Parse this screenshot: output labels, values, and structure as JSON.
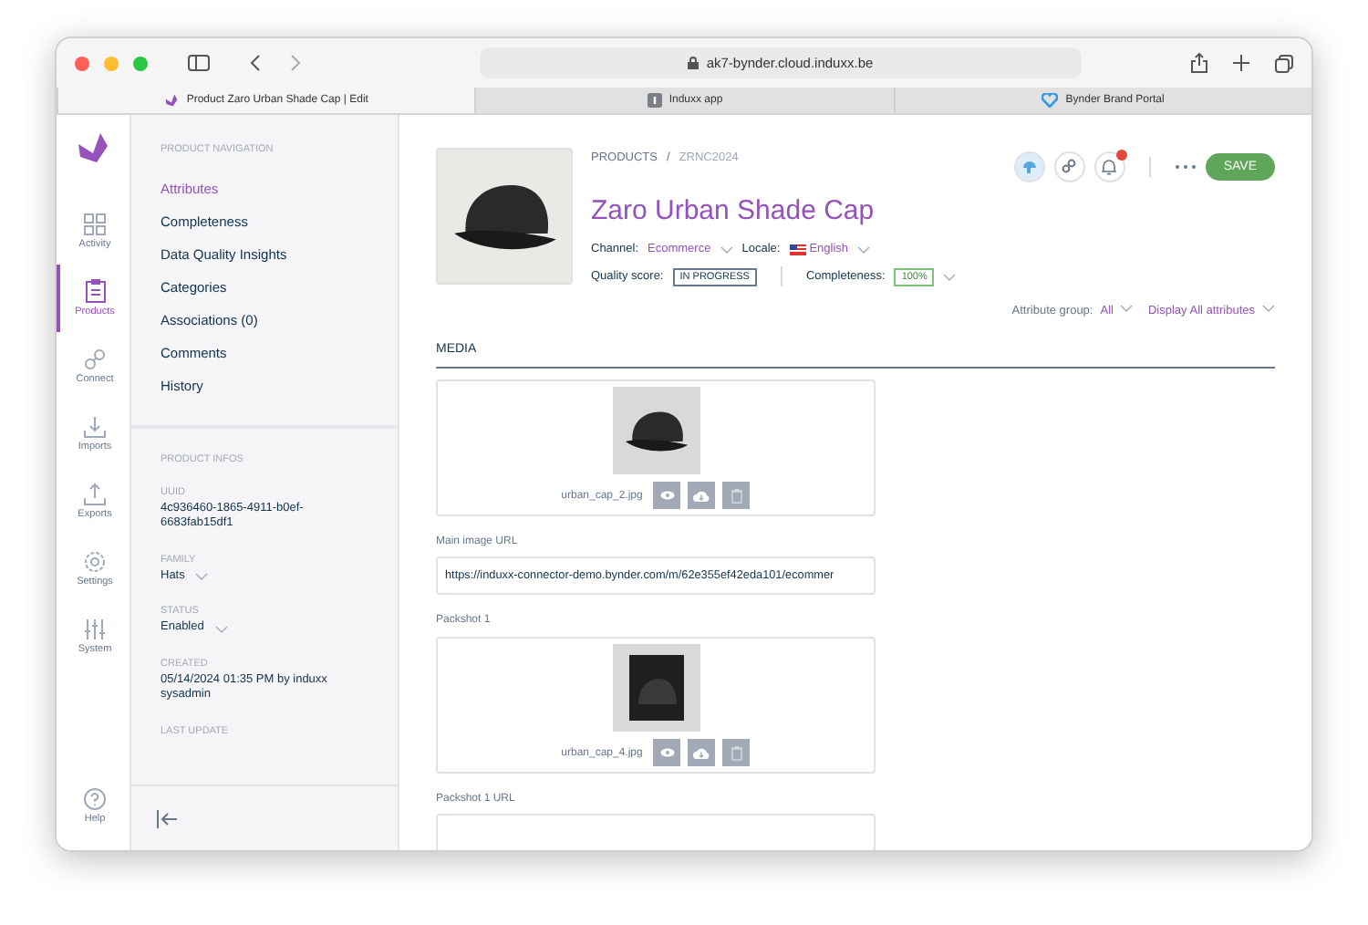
{
  "browser": {
    "url": "ak7-bynder.cloud.induxx.be",
    "tabs": [
      {
        "title": "Product Zaro Urban Shade Cap | Edit",
        "selected": true
      },
      {
        "title": "Induxx app",
        "selected": false
      },
      {
        "title": "Bynder Brand Portal",
        "selected": false
      }
    ]
  },
  "rail": {
    "items": [
      {
        "label": "Activity",
        "selected": false
      },
      {
        "label": "Products",
        "selected": true
      },
      {
        "label": "Connect",
        "selected": false
      },
      {
        "label": "Imports",
        "selected": false
      },
      {
        "label": "Exports",
        "selected": false
      },
      {
        "label": "Settings",
        "selected": false
      },
      {
        "label": "System",
        "selected": false
      }
    ],
    "help": "Help"
  },
  "navigation": {
    "heading": "PRODUCT NAVIGATION",
    "items": [
      {
        "label": "Attributes",
        "selected": true
      },
      {
        "label": "Completeness",
        "selected": false
      },
      {
        "label": "Data Quality Insights",
        "selected": false
      },
      {
        "label": "Categories",
        "selected": false
      },
      {
        "label": "Associations (0)",
        "selected": false
      },
      {
        "label": "Comments",
        "selected": false
      },
      {
        "label": "History",
        "selected": false
      }
    ]
  },
  "infos": {
    "heading": "PRODUCT INFOS",
    "fields": [
      {
        "label": "UUID",
        "value": "4c936460-1865-4911-b0ef-6683fab15df1",
        "dropdown": false
      },
      {
        "label": "FAMILY",
        "value": "Hats",
        "dropdown": true
      },
      {
        "label": "STATUS",
        "value": "Enabled",
        "dropdown": true
      },
      {
        "label": "CREATED",
        "value": "05/14/2024 01:35 PM by induxx sysadmin",
        "dropdown": false
      },
      {
        "label": "LAST UPDATE",
        "dropdown": false
      }
    ]
  },
  "product": {
    "breadcrumb": {
      "section": "PRODUCTS",
      "separator": "/",
      "code": "ZRNC2024"
    },
    "title": "Zaro Urban Shade Cap",
    "channel": {
      "label": "Channel:",
      "value": "Ecommerce"
    },
    "locale": {
      "label": "Locale:",
      "value": "English"
    },
    "quality": {
      "label": "Quality score:",
      "value": "IN PROGRESS"
    },
    "completeness": {
      "label": "Completeness:",
      "value": "100%"
    },
    "attribute_group": {
      "label": "Attribute group:",
      "value": "All"
    },
    "display": "Display All attributes",
    "notification_alert": true,
    "save": "SAVE"
  },
  "media": {
    "heading": "MEDIA",
    "items": [
      {
        "kind": "asset",
        "filename": "urban_cap_2.jpg"
      },
      {
        "kind": "url",
        "label": "Main image URL",
        "value": "https://induxx-connector-demo.bynder.com/m/62e355ef42eda101/ecommer"
      },
      {
        "kind": "asset",
        "label": "Packshot 1",
        "filename": "urban_cap_4.jpg"
      },
      {
        "kind": "url",
        "label": "Packshot 1 URL"
      }
    ]
  }
}
